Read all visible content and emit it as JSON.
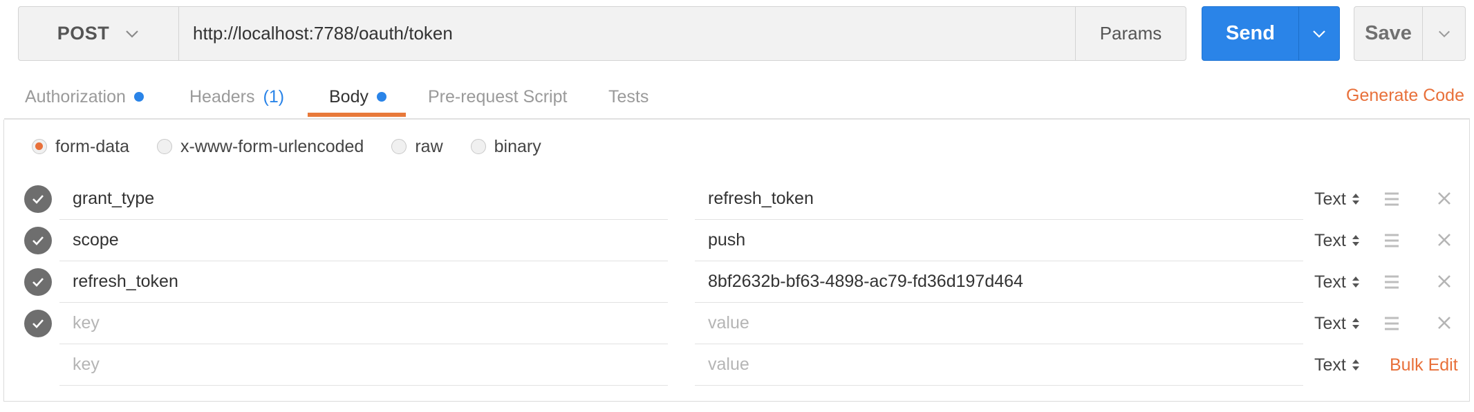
{
  "request": {
    "method": "POST",
    "url": "http://localhost:7788/oauth/token",
    "params_label": "Params",
    "send_label": "Send",
    "save_label": "Save"
  },
  "tabs": [
    {
      "label": "Authorization",
      "indicator": "dot"
    },
    {
      "label": "Headers",
      "count": "(1)"
    },
    {
      "label": "Body",
      "indicator": "dot",
      "active": true
    },
    {
      "label": "Pre-request Script"
    },
    {
      "label": "Tests"
    }
  ],
  "generate_code_label": "Generate Code",
  "body_modes": [
    {
      "label": "form-data",
      "selected": true
    },
    {
      "label": "x-www-form-urlencoded",
      "selected": false
    },
    {
      "label": "raw",
      "selected": false
    },
    {
      "label": "binary",
      "selected": false
    }
  ],
  "form_rows": [
    {
      "key": "grant_type",
      "value": "refresh_token",
      "type": "Text"
    },
    {
      "key": "scope",
      "value": "push",
      "type": "Text"
    },
    {
      "key": "refresh_token",
      "value": "8bf2632b-bf63-4898-ac79-fd36d197d464",
      "type": "Text"
    },
    {
      "key_placeholder": "key",
      "value_placeholder": "value",
      "type": "Text"
    },
    {
      "key_placeholder": "key",
      "value_placeholder": "value",
      "type": "Text"
    }
  ],
  "bulk_edit_label": "Bulk Edit",
  "colors": {
    "accent_orange": "#e8703a",
    "send_blue": "#2a84e8",
    "check_gray": "#6e6e6e"
  }
}
